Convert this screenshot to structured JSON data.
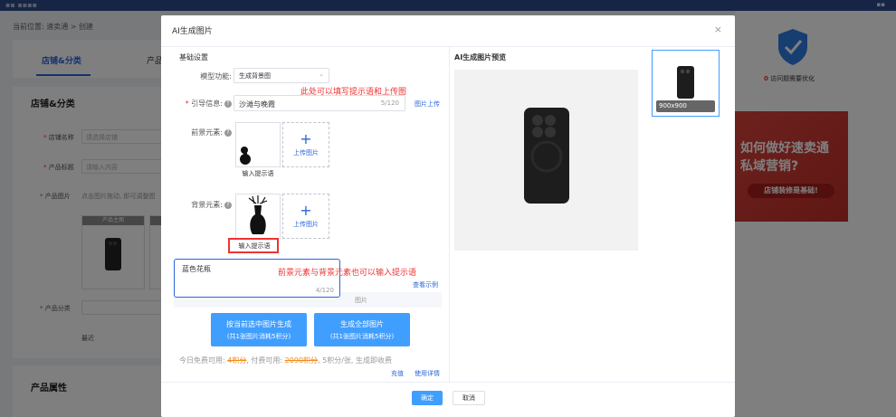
{
  "background": {
    "breadcrumb": "当前位置: 速卖通 > 创建",
    "tabs": [
      "店铺&分类",
      "产品"
    ],
    "section_store": "店铺&分类",
    "fields": {
      "store_name": {
        "label": "店铺名称",
        "placeholder": "请选择店铺"
      },
      "product_title": {
        "label": "产品标题",
        "placeholder": "请输入内容"
      },
      "product_images": {
        "label": "产品图片",
        "hint": "点击图片拖动, 即可调整图"
      },
      "main_image_label": "产品主图",
      "product_category": {
        "label": "产品分类"
      },
      "recent": "最近"
    },
    "section_attributes": "产品属性",
    "right_panel": {
      "visits_count": "0",
      "visits_text": "访问题需要优化",
      "banner_line1": "如何做好速卖通",
      "banner_line2": "私域营销?",
      "banner_button": "店铺装修是基础!"
    }
  },
  "modal": {
    "title": "AI生成图片",
    "close_glyph": "×",
    "basic_settings": "基础设置",
    "model_function": {
      "label": "模型功能:",
      "value": "生成背景图"
    },
    "guide": {
      "label": "引导信息:",
      "value": "沙滩与晚霞",
      "count": "5/120",
      "upload_link": "图片上传"
    },
    "note_top": "此处可以填写提示语和上传图",
    "foreground": {
      "label": "前景元素:",
      "prompt": "输入提示语",
      "upload": "上传图片"
    },
    "background_el": {
      "label": "背景元素:",
      "prompt": "输入提示语",
      "upload": "上传图片"
    },
    "textarea": {
      "value": "蓝色花瓶",
      "count": "4/120"
    },
    "note_bottom": "前景元素与背景元素也可以输入提示语",
    "example_link": "查看示例",
    "strip_text": "图片",
    "btn_gen_selected": {
      "line1": "按当前选中图片生成",
      "line2": "(共1张图片消耗5积分)"
    },
    "btn_gen_all": {
      "line1": "生成全部图片",
      "line2": "(共1张图片消耗5积分)"
    },
    "quota": {
      "prefix": "今日免费可用: ",
      "free": "4积分",
      "mid": ", 付费可用: ",
      "paid": "2090积分",
      "suffix": ", 5积分/张, 生成即收费"
    },
    "recharge": "充值",
    "usage": "使用详情",
    "preview_title": "AI生成图片预览",
    "thumb_size": "900x900",
    "ok": "确定",
    "cancel": "取消"
  },
  "colors": {
    "accent": "#409eff",
    "danger": "#e33333",
    "orange": "#f08c1c"
  }
}
